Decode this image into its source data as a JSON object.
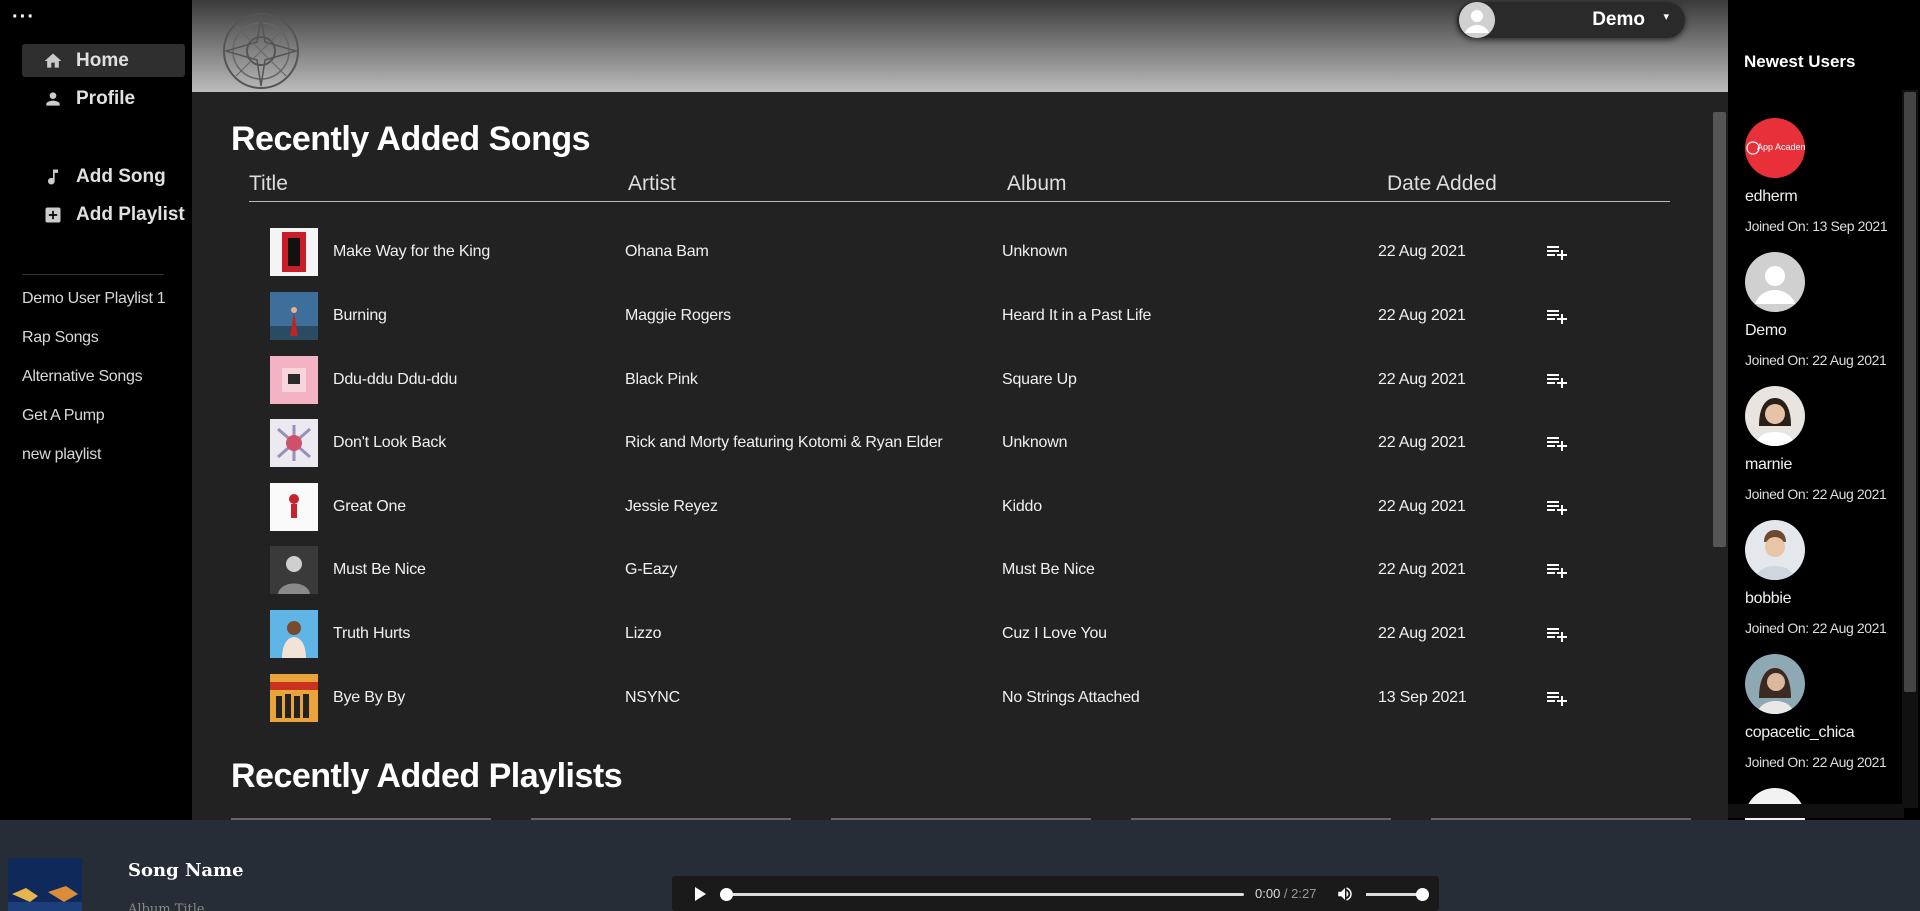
{
  "sidebar": {
    "menu_glyph": "···",
    "nav": [
      {
        "label": "Home",
        "icon": "home-icon"
      },
      {
        "label": "Profile",
        "icon": "person-icon"
      },
      {
        "label": "Add Song",
        "icon": "music-note-icon"
      },
      {
        "label": "Add Playlist",
        "icon": "add-box-icon"
      }
    ],
    "playlists": [
      "Demo User Playlist 1",
      "Rap Songs",
      "Alternative Songs",
      "Get A Pump",
      "new playlist"
    ]
  },
  "header": {
    "user_name": "Demo",
    "caret": "▾"
  },
  "songs_section": {
    "title": "Recently Added Songs",
    "columns": [
      "Title",
      "Artist",
      "Album",
      "Date Added"
    ],
    "rows": [
      {
        "title": "Make Way for the King",
        "artist": "Ohana Bam",
        "album": "Unknown",
        "date": "22 Aug 2021"
      },
      {
        "title": "Burning",
        "artist": "Maggie Rogers",
        "album": "Heard It in a Past Life",
        "date": "22 Aug 2021"
      },
      {
        "title": "Ddu-ddu Ddu-ddu",
        "artist": "Black Pink",
        "album": "Square Up",
        "date": "22 Aug 2021"
      },
      {
        "title": "Don't Look Back",
        "artist": "Rick and Morty featuring Kotomi & Ryan Elder",
        "album": "Unknown",
        "date": "22 Aug 2021"
      },
      {
        "title": "Great One",
        "artist": "Jessie Reyez",
        "album": "Kiddo",
        "date": "22 Aug 2021"
      },
      {
        "title": "Must Be Nice",
        "artist": "G-Eazy",
        "album": "Must Be Nice",
        "date": "22 Aug 2021"
      },
      {
        "title": "Truth Hurts",
        "artist": "Lizzo",
        "album": "Cuz I Love You",
        "date": "22 Aug 2021"
      },
      {
        "title": "Bye By By",
        "artist": "NSYNC",
        "album": "No Strings Attached",
        "date": "13 Sep 2021"
      }
    ]
  },
  "playlists_section": {
    "title": "Recently Added Playlists"
  },
  "newest_users": {
    "title": "Newest Users",
    "users": [
      {
        "name": "edherm",
        "joined": "Joined On: 13 Sep 2021",
        "avatar_text": "App Academy"
      },
      {
        "name": "Demo",
        "joined": "Joined On: 22 Aug 2021"
      },
      {
        "name": "marnie",
        "joined": "Joined On: 22 Aug 2021"
      },
      {
        "name": "bobbie",
        "joined": "Joined On: 22 Aug 2021"
      },
      {
        "name": "copacetic_chica",
        "joined": "Joined On: 22 Aug 2021"
      }
    ]
  },
  "player": {
    "song_name": "Song Name",
    "album_title": "Album Title",
    "current_time": "0:00",
    "separator": " / ",
    "duration": "2:27",
    "progress": 0.0,
    "volume": 1.0
  },
  "colors": {
    "main_bg": "#222222",
    "sidebar_bg": "#000000",
    "player_bg": "#262d36",
    "accent_red": "#e8303a"
  }
}
